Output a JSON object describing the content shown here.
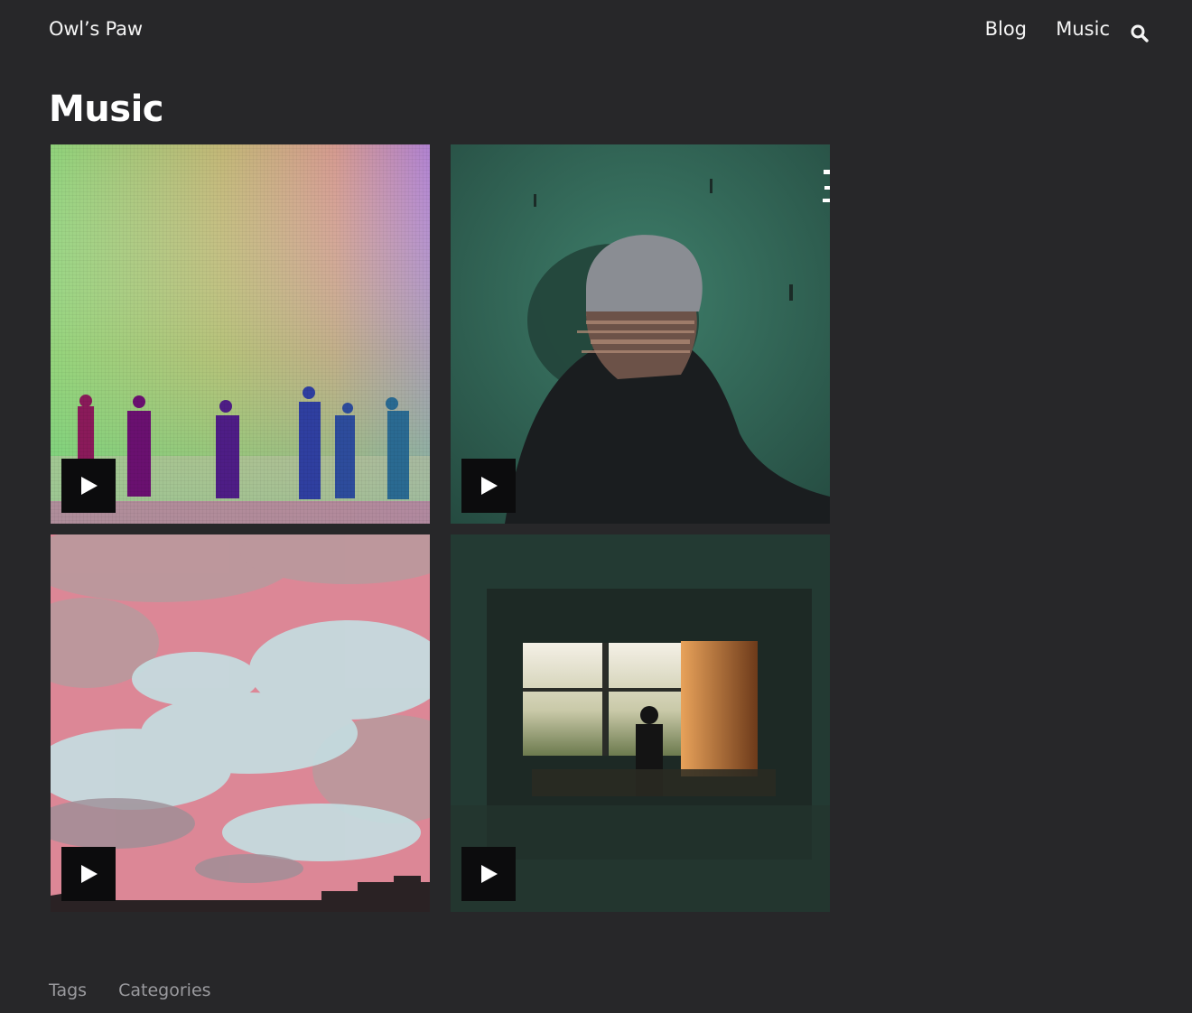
{
  "header": {
    "site_title": "Owl’s Paw",
    "nav": [
      {
        "label": "Blog"
      },
      {
        "label": "Music"
      }
    ],
    "search_icon": "search-icon"
  },
  "page": {
    "title": "Music"
  },
  "tiles": [
    {
      "artwork": "silhouettes-pastel-gradient",
      "control_icon": "play-icon"
    },
    {
      "artwork": "glitched-hooded-figure",
      "control_icon": "play-icon"
    },
    {
      "artwork": "pink-cloudy-sky",
      "control_icon": "play-icon"
    },
    {
      "artwork": "figure-at-window-dark-room",
      "control_icon": "play-icon"
    }
  ],
  "footer": {
    "links": [
      {
        "label": "Tags"
      },
      {
        "label": "Categories"
      }
    ]
  },
  "colors": {
    "background": "#272729",
    "text": "#f5f5f5",
    "muted": "#9a9a9e",
    "play_bg": "#0c0c0d"
  }
}
